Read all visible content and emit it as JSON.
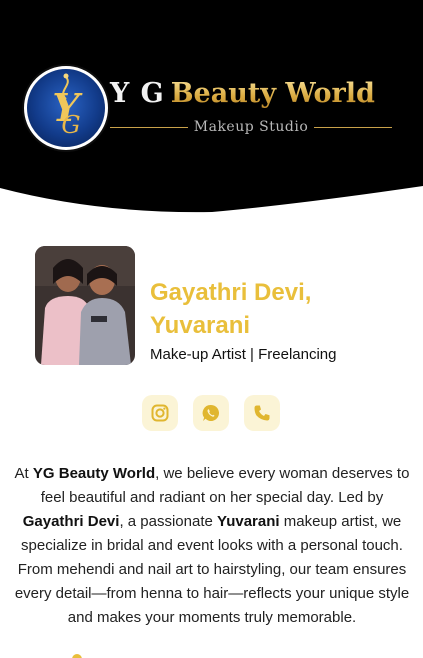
{
  "header": {
    "brand_prefix": "Y G",
    "brand_name": "Beauty World",
    "tagline": "Makeup Studio",
    "logo_icon": "yg-monogram-icon"
  },
  "profile": {
    "photo_icon": "profile-photo",
    "name": "Gayathri Devi, Yuvarani",
    "role": "Make-up Artist | Freelancing"
  },
  "social": [
    {
      "name": "instagram-icon"
    },
    {
      "name": "whatsapp-icon"
    },
    {
      "name": "phone-icon"
    }
  ],
  "about": {
    "part1": "At ",
    "brand": "YG Beauty World",
    "part2": ", we believe every woman deserves to feel beautiful and radiant on her special day. Led by ",
    "person1": "Gayathri Devi",
    "part3": ", a passionate ",
    "person2": "Yuvarani",
    "part4": " makeup artist, we specialize in bridal and event looks with a personal touch. From mehendi and nail art to hairstyling, our team ensures every detail—from henna to hair—reflects your unique style and makes your moments truly memorable."
  },
  "colors": {
    "accent_gold": "#e9bf3b",
    "header_bg": "#000000",
    "icon_bg": "#fbf4d6"
  }
}
